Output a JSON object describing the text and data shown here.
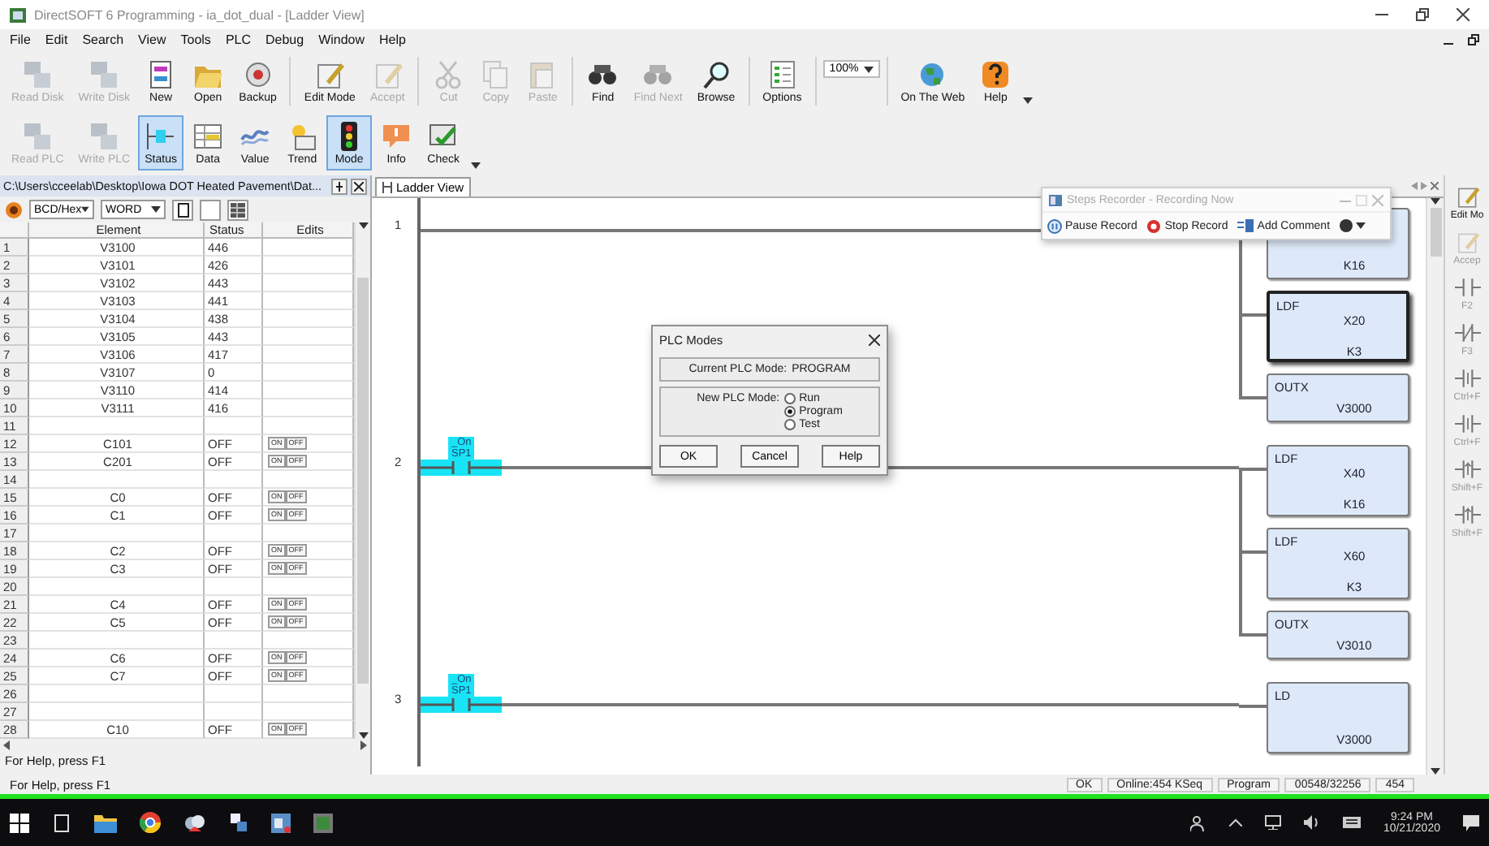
{
  "window": {
    "title": "DirectSOFT 6 Programming - ia_dot_dual - [Ladder View]"
  },
  "menu": [
    "File",
    "Edit",
    "Search",
    "View",
    "Tools",
    "PLC",
    "Debug",
    "Window",
    "Help"
  ],
  "toolbar": [
    [
      {
        "kind": "button",
        "label": "Read Disk",
        "disabled": true,
        "selected": false
      },
      {
        "kind": "button",
        "label": "Write Disk",
        "disabled": true,
        "selected": false
      },
      {
        "kind": "button",
        "label": "New",
        "disabled": false,
        "selected": false
      },
      {
        "kind": "button",
        "label": "Open",
        "disabled": false,
        "selected": false
      },
      {
        "kind": "button",
        "label": "Backup",
        "disabled": false,
        "selected": false
      },
      {
        "kind": "separator"
      },
      {
        "kind": "button",
        "label": "Edit Mode",
        "disabled": false,
        "selected": false
      },
      {
        "kind": "button",
        "label": "Accept",
        "disabled": true,
        "selected": false
      },
      {
        "kind": "separator"
      },
      {
        "kind": "button",
        "label": "Cut",
        "disabled": true,
        "selected": false
      },
      {
        "kind": "button",
        "label": "Copy",
        "disabled": true,
        "selected": false
      },
      {
        "kind": "button",
        "label": "Paste",
        "disabled": true,
        "selected": false
      },
      {
        "kind": "separator"
      },
      {
        "kind": "button",
        "label": "Find",
        "disabled": false,
        "selected": false
      },
      {
        "kind": "button",
        "label": "Find Next",
        "disabled": true,
        "selected": false
      },
      {
        "kind": "button",
        "label": "Browse",
        "disabled": false,
        "selected": false
      },
      {
        "kind": "separator"
      },
      {
        "kind": "button",
        "label": "Options",
        "disabled": false,
        "selected": false
      },
      {
        "kind": "separator"
      },
      {
        "kind": "dropdown",
        "label": "100%"
      },
      {
        "kind": "separator"
      },
      {
        "kind": "button",
        "label": "On The Web",
        "disabled": false,
        "selected": false
      },
      {
        "kind": "button",
        "label": "Help",
        "disabled": false,
        "selected": false
      },
      {
        "kind": "more"
      }
    ],
    [
      {
        "kind": "button",
        "label": "Read PLC",
        "disabled": true,
        "selected": false
      },
      {
        "kind": "button",
        "label": "Write PLC",
        "disabled": true,
        "selected": false
      },
      {
        "kind": "button",
        "label": "Status",
        "disabled": false,
        "selected": true
      },
      {
        "kind": "button",
        "label": "Data",
        "disabled": false,
        "selected": false
      },
      {
        "kind": "button",
        "label": "Value",
        "disabled": false,
        "selected": false
      },
      {
        "kind": "button",
        "label": "Trend",
        "disabled": false,
        "selected": false
      },
      {
        "kind": "button",
        "label": "Mode",
        "disabled": false,
        "selected": true
      },
      {
        "kind": "button",
        "label": "Info",
        "disabled": false,
        "selected": false
      },
      {
        "kind": "button",
        "label": "Check",
        "disabled": false,
        "selected": false
      },
      {
        "kind": "more"
      }
    ]
  ],
  "data_view": {
    "path": "C:\\Users\\cceelab\\Desktop\\Iowa DOT Heated Pavement\\Dat...",
    "format": "BCD/Hex",
    "type": "WORD",
    "columns": [
      "Element",
      "Status",
      "Edits"
    ],
    "rows": [
      {
        "number": "1",
        "element": "V3100",
        "status": "446"
      },
      {
        "number": "2",
        "element": "V3101",
        "status": "426"
      },
      {
        "number": "3",
        "element": "V3102",
        "status": "443"
      },
      {
        "number": "4",
        "element": "V3103",
        "status": "441"
      },
      {
        "number": "5",
        "element": "V3104",
        "status": "438"
      },
      {
        "number": "6",
        "element": "V3105",
        "status": "443"
      },
      {
        "number": "7",
        "element": "V3106",
        "status": "417"
      },
      {
        "number": "8",
        "element": "V3107",
        "status": "0"
      },
      {
        "number": "9",
        "element": "V3110",
        "status": "414"
      },
      {
        "number": "10",
        "element": "V3111",
        "status": "416"
      },
      {
        "number": "11"
      },
      {
        "number": "12",
        "element": "C101",
        "status": "OFF",
        "edits": [
          "ON",
          "OFF"
        ]
      },
      {
        "number": "13",
        "element": "C201",
        "status": "OFF",
        "edits": [
          "ON",
          "OFF"
        ]
      },
      {
        "number": "14"
      },
      {
        "number": "15",
        "element": "C0",
        "status": "OFF",
        "edits": [
          "ON",
          "OFF"
        ]
      },
      {
        "number": "16",
        "element": "C1",
        "status": "OFF",
        "edits": [
          "ON",
          "OFF"
        ]
      },
      {
        "number": "17"
      },
      {
        "number": "18",
        "element": "C2",
        "status": "OFF",
        "edits": [
          "ON",
          "OFF"
        ]
      },
      {
        "number": "19",
        "element": "C3",
        "status": "OFF",
        "edits": [
          "ON",
          "OFF"
        ]
      },
      {
        "number": "20"
      },
      {
        "number": "21",
        "element": "C4",
        "status": "OFF",
        "edits": [
          "ON",
          "OFF"
        ]
      },
      {
        "number": "22",
        "element": "C5",
        "status": "OFF",
        "edits": [
          "ON",
          "OFF"
        ]
      },
      {
        "number": "23"
      },
      {
        "number": "24",
        "element": "C6",
        "status": "OFF",
        "edits": [
          "ON",
          "OFF"
        ]
      },
      {
        "number": "25",
        "element": "C7",
        "status": "OFF",
        "edits": [
          "ON",
          "OFF"
        ]
      },
      {
        "number": "26"
      },
      {
        "number": "27"
      },
      {
        "number": "28",
        "element": "C10",
        "status": "OFF",
        "edits": [
          "ON",
          "OFF"
        ]
      }
    ],
    "help": "For Help, press F1"
  },
  "ladder": {
    "tab": "Ladder View",
    "rungs": [
      {
        "number": "1",
        "boxes": [
          {
            "kind": "load",
            "args": [
              "K16"
            ],
            "selected": false
          },
          {
            "kind": "load",
            "op": "LDF",
            "args": [
              "X20",
              "K3"
            ],
            "selected": true
          },
          {
            "kind": "output",
            "op": "OUTX",
            "args": [
              "V3000"
            ],
            "selected": false
          }
        ]
      },
      {
        "number": "2",
        "contact": {
          "nickname": "_On",
          "address": "SP1"
        },
        "boxes": [
          {
            "kind": "load",
            "op": "LDF",
            "args": [
              "X40",
              "K16"
            ],
            "selected": false
          },
          {
            "kind": "load",
            "op": "LDF",
            "args": [
              "X60",
              "K3"
            ],
            "selected": false
          },
          {
            "kind": "output",
            "op": "OUTX",
            "args": [
              "V3010"
            ],
            "selected": false
          }
        ]
      },
      {
        "number": "3",
        "contact": {
          "nickname": "_On",
          "address": "SP1"
        },
        "boxes": [
          {
            "kind": "load",
            "op": "LD",
            "args": [
              "V3000"
            ],
            "selected": false
          }
        ]
      }
    ]
  },
  "palette": [
    {
      "label": "Edit Mo",
      "disabled": false
    },
    {
      "label": "Accep",
      "disabled": true
    },
    {
      "label": "F2",
      "disabled": true
    },
    {
      "label": "F3",
      "disabled": true
    },
    {
      "label": "Ctrl+F",
      "disabled": true
    },
    {
      "label": "Ctrl+F",
      "disabled": true
    },
    {
      "label": "Shift+F",
      "disabled": true
    },
    {
      "label": "Shift+F",
      "disabled": true
    }
  ],
  "plc_modes": {
    "title": "PLC Modes",
    "current_label": "Current PLC Mode:",
    "current": "PROGRAM",
    "new_label": "New PLC Mode:",
    "options": [
      {
        "label": "Run",
        "selected": false
      },
      {
        "label": "Program",
        "selected": true
      },
      {
        "label": "Test",
        "selected": false
      }
    ],
    "buttons": [
      "OK",
      "Cancel",
      "Help"
    ]
  },
  "steps_recorder": {
    "title": "Steps Recorder - Recording Now",
    "buttons": [
      {
        "kind": "pause",
        "label": "Pause Record"
      },
      {
        "kind": "stop",
        "label": "Stop Record"
      },
      {
        "kind": "comment",
        "label": "Add Comment"
      }
    ]
  },
  "status_bar": {
    "help": "For Help, press F1",
    "fields": [
      "OK",
      "Online:454 KSeq",
      "Program",
      "00548/32256",
      "454"
    ]
  },
  "taskbar": {
    "time": "9:24 PM",
    "date": "10/21/2020"
  }
}
